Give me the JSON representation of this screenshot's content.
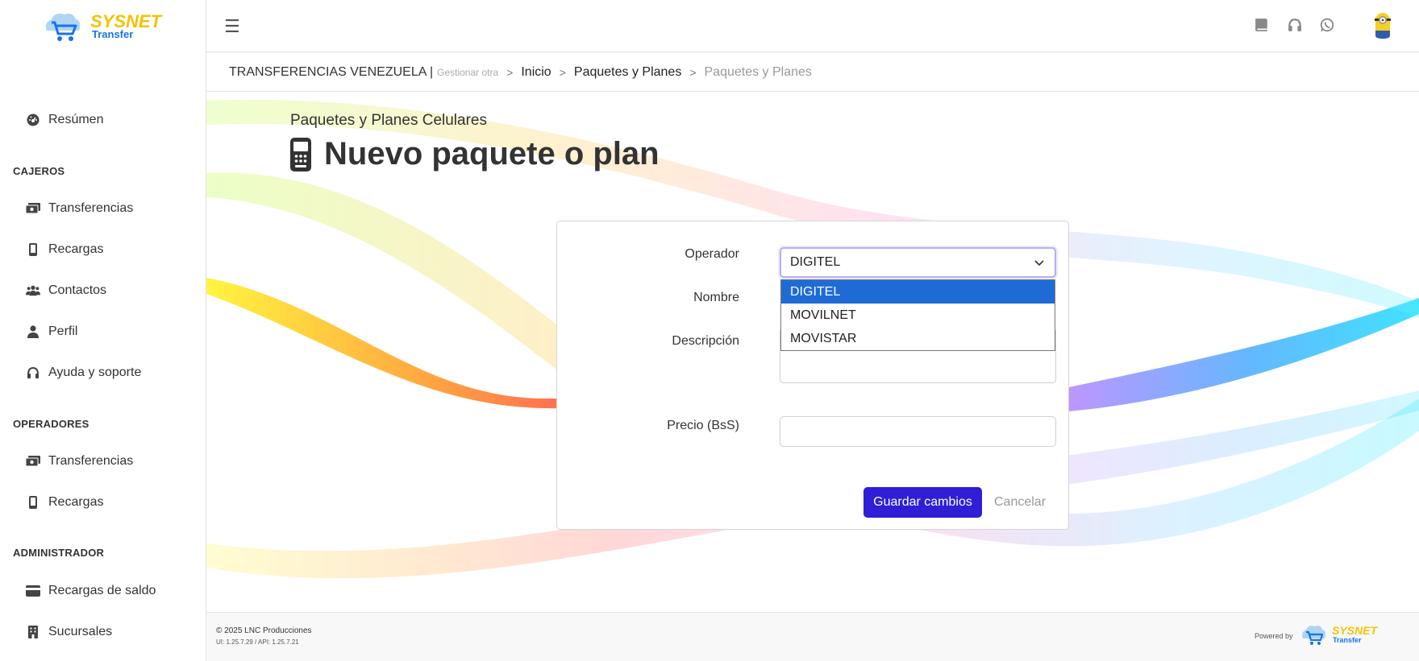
{
  "brand": {
    "logo_name": "SYSNET",
    "logo_sub": "Transfer"
  },
  "sidebar": {
    "summary": {
      "label": "Resúmen",
      "icon": "gauge-icon"
    },
    "sections": [
      {
        "heading": "CAJEROS",
        "items": [
          {
            "label": "Transferencias",
            "icon": "money-icon"
          },
          {
            "label": "Recargas",
            "icon": "mobile-icon"
          },
          {
            "label": "Contactos",
            "icon": "users-icon"
          },
          {
            "label": "Perfil",
            "icon": "user-icon"
          },
          {
            "label": "Ayuda y soporte",
            "icon": "headset-icon"
          }
        ]
      },
      {
        "heading": "OPERADORES",
        "items": [
          {
            "label": "Transferencias",
            "icon": "money-icon"
          },
          {
            "label": "Recargas",
            "icon": "mobile-icon"
          }
        ]
      },
      {
        "heading": "ADMINISTRADOR",
        "items": [
          {
            "label": "Recargas de saldo",
            "icon": "credit-card-icon"
          },
          {
            "label": "Sucursales",
            "icon": "building-icon"
          }
        ]
      }
    ]
  },
  "topbar": {
    "icons": [
      "book-icon",
      "headset-icon",
      "whatsapp-icon"
    ],
    "avatar": "minion-avatar"
  },
  "breadcrumb": {
    "company": "TRANSFERENCIAS VENEZUELA |",
    "manage": "Gestionar otra",
    "sep": ">",
    "items": [
      "Inicio",
      "Paquetes y Planes"
    ],
    "current": "Paquetes y Planes"
  },
  "page": {
    "subtitle": "Paquetes y Planes Celulares",
    "title": "Nuevo paquete o plan"
  },
  "form": {
    "operator_label": "Operador",
    "operator_value": "DIGITEL",
    "operator_options": [
      "DIGITEL",
      "MOVILNET",
      "MOVISTAR"
    ],
    "name_label": "Nombre",
    "description_label": "Descripción",
    "price_label": "Precio (BsS)",
    "save_label": "Guardar cambios",
    "cancel_label": "Cancelar"
  },
  "footer": {
    "copyright": "© 2025 LNC Producciones",
    "version": "UI: 1.25.7.29 / API: 1.25.7.21",
    "powered_by": "Powered by"
  },
  "colors": {
    "primary": "#2f1ed6",
    "selected_option": "#1e6bd6",
    "logo_yellow": "#f5c200",
    "logo_blue": "#1a73e8"
  }
}
